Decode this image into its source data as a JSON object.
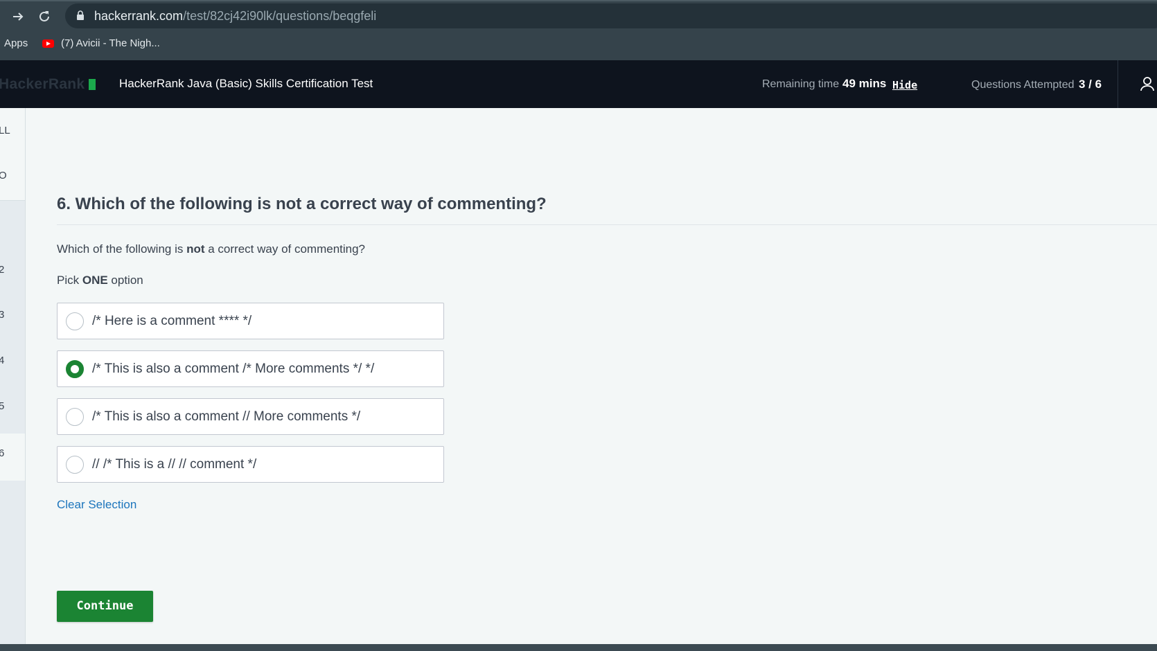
{
  "browser": {
    "url_host": "hackerrank.com",
    "url_path": "/test/82cj42i90lk/questions/beqgfeli",
    "bookmarks": [
      {
        "label": "Apps",
        "icon": "apps-icon"
      },
      {
        "label": "(7) Avicii - The Nigh...",
        "icon": "youtube-icon"
      }
    ]
  },
  "header": {
    "logo": "HackerRank",
    "test_title": "HackerRank Java (Basic) Skills Certification Test",
    "remaining_label": "Remaining time",
    "remaining_value": "49 mins",
    "hide_label": "Hide",
    "attempted_label": "Questions Attempted",
    "attempted_value": "3 / 6"
  },
  "sidebar": {
    "items": [
      "LL",
      "O",
      "2",
      "3",
      "4",
      "5",
      "6"
    ]
  },
  "question": {
    "title": "6. Which of the following is not a correct way of commenting?",
    "body_before": "Which of the following is ",
    "body_bold": "not",
    "body_after": " a correct way of commenting?",
    "pick_before": "Pick ",
    "pick_bold": "ONE",
    "pick_after": " option",
    "options": [
      {
        "label": "/* Here is a comment **** */",
        "selected": false
      },
      {
        "label": "/* This is also a comment /* More comments */ */",
        "selected": true
      },
      {
        "label": "/* This is also a comment // More comments */",
        "selected": false
      },
      {
        "label": "// /* This is a // // comment */",
        "selected": false
      }
    ],
    "clear_label": "Clear Selection",
    "continue_label": "Continue"
  },
  "colors": {
    "accent_green": "#1b8433",
    "header_bg": "#0e141e",
    "link_blue": "#1c75bc"
  }
}
